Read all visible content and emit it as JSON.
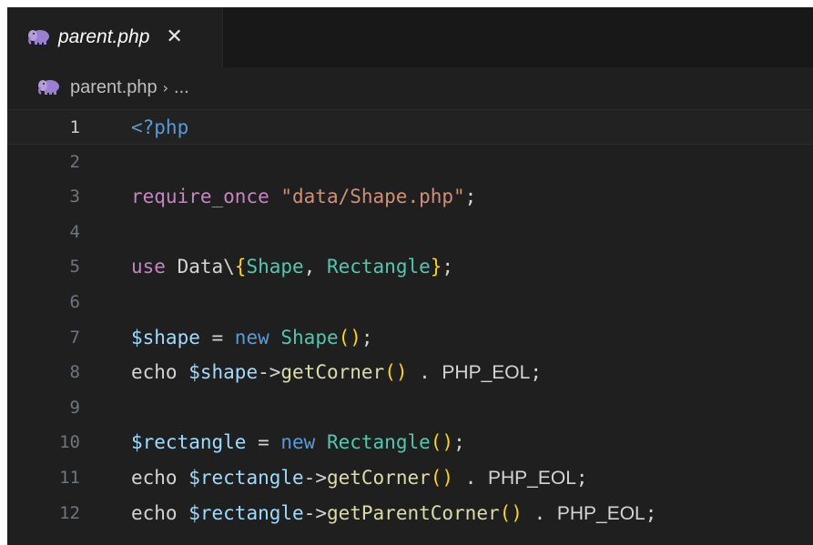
{
  "tab": {
    "label": "parent.php",
    "icon": "php-elephant-icon",
    "close": "✕"
  },
  "breadcrumb": {
    "file": "parent.php",
    "separator": "›",
    "rest": "..."
  },
  "active_line": 1,
  "lines": [
    {
      "n": "1",
      "tokens": [
        {
          "t": "<?php",
          "c": "tag"
        }
      ]
    },
    {
      "n": "2",
      "tokens": []
    },
    {
      "n": "3",
      "tokens": [
        {
          "t": "require_once",
          "c": "kw"
        },
        {
          "t": " ",
          "c": "plain"
        },
        {
          "t": "\"data/Shape.php\"",
          "c": "str"
        },
        {
          "t": ";",
          "c": "plain"
        }
      ]
    },
    {
      "n": "4",
      "tokens": []
    },
    {
      "n": "5",
      "tokens": [
        {
          "t": "use",
          "c": "kw"
        },
        {
          "t": " Data\\",
          "c": "plain"
        },
        {
          "t": "{",
          "c": "brace"
        },
        {
          "t": "Shape",
          "c": "cls"
        },
        {
          "t": ", ",
          "c": "plain"
        },
        {
          "t": "Rectangle",
          "c": "cls"
        },
        {
          "t": "}",
          "c": "brace"
        },
        {
          "t": ";",
          "c": "plain"
        }
      ]
    },
    {
      "n": "6",
      "tokens": []
    },
    {
      "n": "7",
      "tokens": [
        {
          "t": "$shape",
          "c": "var"
        },
        {
          "t": " = ",
          "c": "plain"
        },
        {
          "t": "new",
          "c": "kw2"
        },
        {
          "t": " ",
          "c": "plain"
        },
        {
          "t": "Shape",
          "c": "cls"
        },
        {
          "t": "()",
          "c": "brace"
        },
        {
          "t": ";",
          "c": "plain"
        }
      ]
    },
    {
      "n": "8",
      "tokens": [
        {
          "t": "echo",
          "c": "plain"
        },
        {
          "t": " ",
          "c": "plain"
        },
        {
          "t": "$shape",
          "c": "var"
        },
        {
          "t": "->",
          "c": "plain"
        },
        {
          "t": "getCorner",
          "c": "fn"
        },
        {
          "t": "()",
          "c": "brace"
        },
        {
          "t": " . ",
          "c": "plain"
        },
        {
          "t": "PHP_EOL",
          "c": "const"
        },
        {
          "t": ";",
          "c": "plain"
        }
      ]
    },
    {
      "n": "9",
      "tokens": []
    },
    {
      "n": "10",
      "tokens": [
        {
          "t": "$rectangle",
          "c": "var"
        },
        {
          "t": " = ",
          "c": "plain"
        },
        {
          "t": "new",
          "c": "kw2"
        },
        {
          "t": " ",
          "c": "plain"
        },
        {
          "t": "Rectangle",
          "c": "cls"
        },
        {
          "t": "()",
          "c": "brace"
        },
        {
          "t": ";",
          "c": "plain"
        }
      ]
    },
    {
      "n": "11",
      "tokens": [
        {
          "t": "echo",
          "c": "plain"
        },
        {
          "t": " ",
          "c": "plain"
        },
        {
          "t": "$rectangle",
          "c": "var"
        },
        {
          "t": "->",
          "c": "plain"
        },
        {
          "t": "getCorner",
          "c": "fn"
        },
        {
          "t": "()",
          "c": "brace"
        },
        {
          "t": " . ",
          "c": "plain"
        },
        {
          "t": "PHP_EOL",
          "c": "const"
        },
        {
          "t": ";",
          "c": "plain"
        }
      ]
    },
    {
      "n": "12",
      "tokens": [
        {
          "t": "echo",
          "c": "plain"
        },
        {
          "t": " ",
          "c": "plain"
        },
        {
          "t": "$rectangle",
          "c": "var"
        },
        {
          "t": "->",
          "c": "plain"
        },
        {
          "t": "getParentCorner",
          "c": "fn"
        },
        {
          "t": "()",
          "c": "brace"
        },
        {
          "t": " . ",
          "c": "plain"
        },
        {
          "t": "PHP_EOL",
          "c": "const"
        },
        {
          "t": ";",
          "c": "plain"
        }
      ]
    }
  ],
  "colors": {
    "editor_bg": "#1f1f1f",
    "tag": "#569cd6",
    "keyword": "#c586c0",
    "string": "#ce9178",
    "variable": "#9cdcfe",
    "class": "#4ec9b0",
    "function": "#dcdcaa",
    "bracket": "#ffd700"
  }
}
